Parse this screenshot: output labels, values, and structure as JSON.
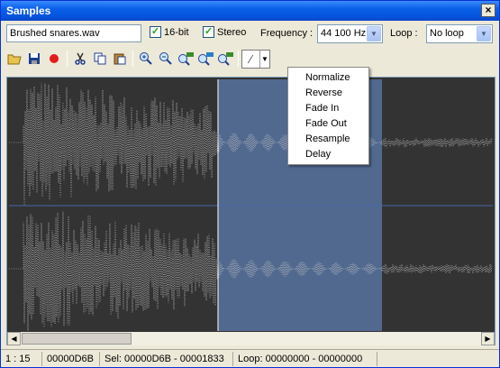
{
  "window": {
    "title": "Samples",
    "close": "×"
  },
  "controls": {
    "filename": "Brushed snares.wav",
    "bit16_label": "16-bit",
    "stereo_label": "Stereo",
    "frequency_label": "Frequency :",
    "frequency_value": "44 100 Hz",
    "loop_label": "Loop :",
    "loop_value": "No loop"
  },
  "toolbar": [
    "open-folder-icon",
    "save-icon",
    "record-icon",
    "cut-icon",
    "copy-icon",
    "paste-icon",
    "zoom-in-icon",
    "zoom-out-icon",
    "zoom-all-icon",
    "zoom-selection-icon",
    "zoom-loop-icon",
    "pencil-icon"
  ],
  "menu": [
    "Normalize",
    "Reverse",
    "Fade In",
    "Fade Out",
    "Resample",
    "Delay"
  ],
  "status": {
    "position": "1 : 15",
    "offset": "00000D6B",
    "selection": "Sel: 00000D6B - 00001833",
    "loop": "Loop: 00000000 - 00000000"
  },
  "colors": {
    "selection": "#51698f",
    "waveform": "#c8c8c8",
    "selected_waveform": "#ffffff",
    "background": "#333333"
  }
}
